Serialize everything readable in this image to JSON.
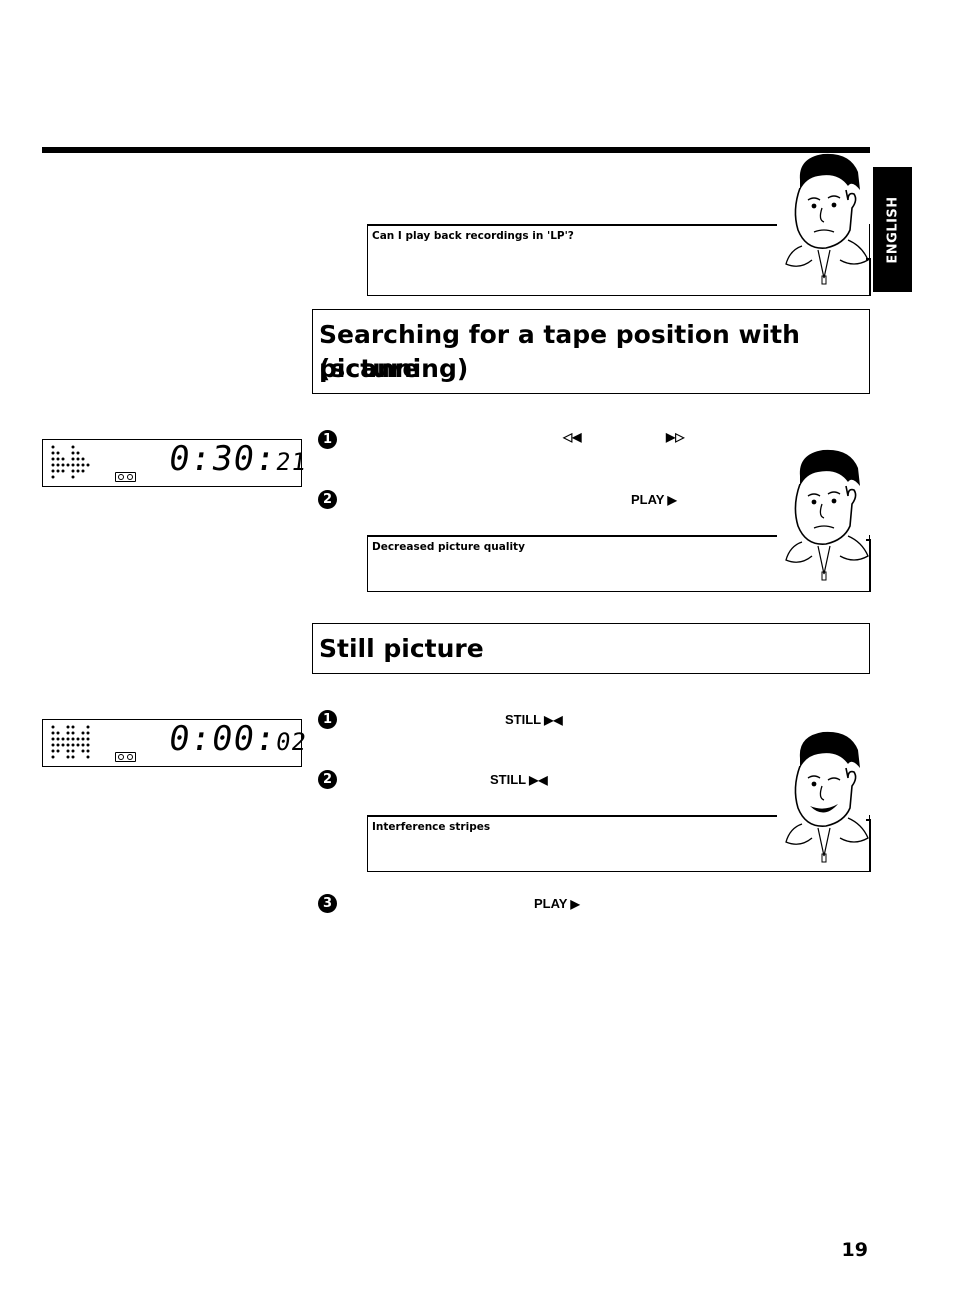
{
  "page": {
    "language_tab": "ENGLISH",
    "page_number": "19"
  },
  "tips": [
    {
      "title": "Can I play back recordings in 'LP'?"
    },
    {
      "title": "Decreased picture quality"
    },
    {
      "title": "Interference stripes"
    }
  ],
  "sections": [
    {
      "title_line1": "Searching for a tape position with picture",
      "title_line2": "(scanning)",
      "display": {
        "time_main": "0:30:",
        "time_small": "21",
        "mode_icon": "fast-forward-dots-icon"
      },
      "steps": [
        {
          "number": "1",
          "keys": [
            {
              "label": "",
              "icon": "rewind-icon",
              "glyph": "◁◀"
            },
            {
              "label": "",
              "icon": "fast-forward-icon",
              "glyph": "▶▷"
            }
          ]
        },
        {
          "number": "2",
          "keys": [
            {
              "label": "PLAY",
              "icon": "play-icon",
              "glyph": "▶"
            }
          ]
        }
      ]
    },
    {
      "title": "Still picture",
      "display": {
        "time_main": "0:00:",
        "time_small": "02",
        "mode_icon": "still-dots-icon"
      },
      "steps": [
        {
          "number": "1",
          "keys": [
            {
              "label": "STILL",
              "icon": "still-icon",
              "glyph": "▶◀"
            }
          ]
        },
        {
          "number": "2",
          "keys": [
            {
              "label": "STILL",
              "icon": "still-icon",
              "glyph": "▶◀"
            }
          ]
        },
        {
          "number": "3",
          "keys": [
            {
              "label": "PLAY",
              "icon": "play-icon",
              "glyph": "▶"
            }
          ]
        }
      ]
    }
  ]
}
